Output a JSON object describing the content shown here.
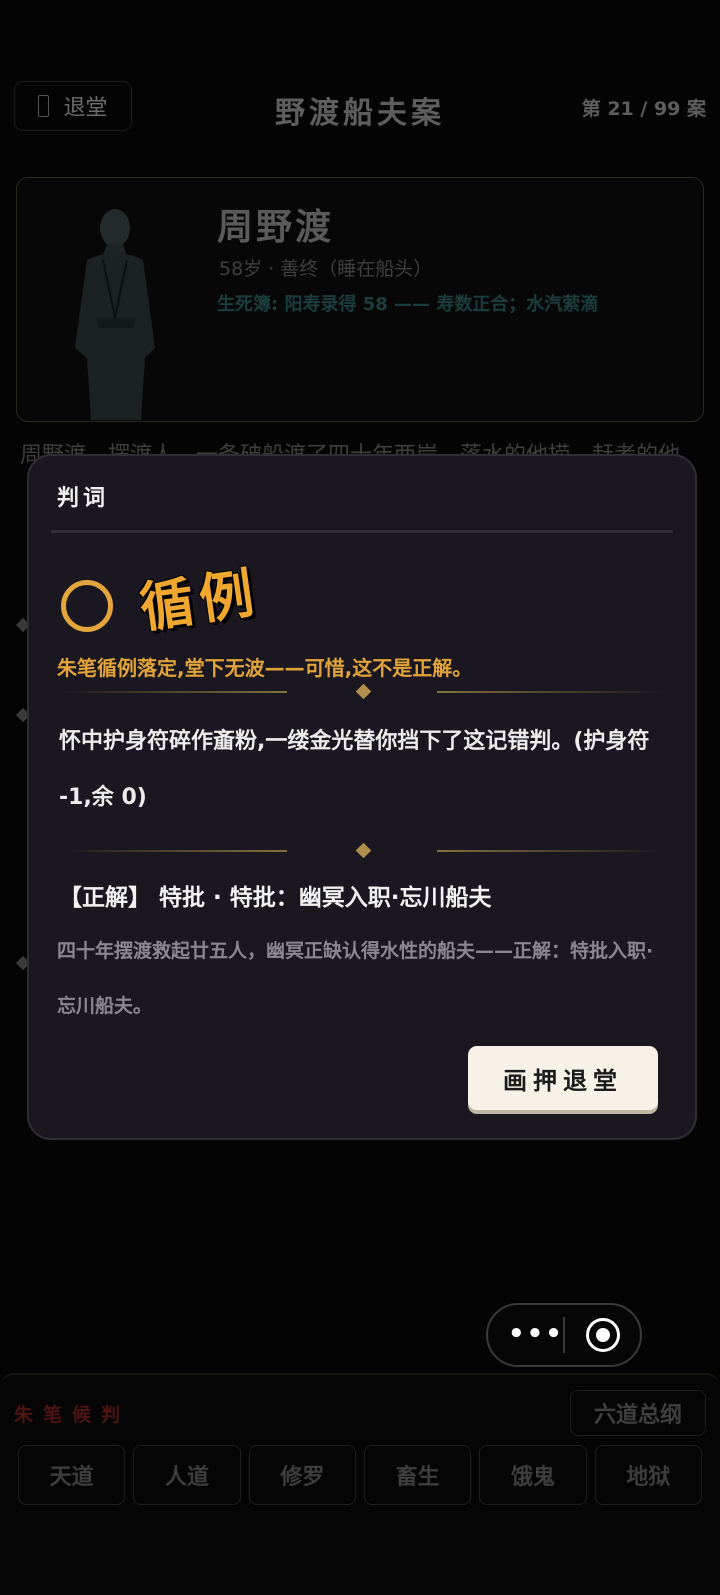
{
  "header": {
    "back_label": "退堂",
    "title": "野渡船夫案",
    "case_count": "第 21 / 99 案"
  },
  "profile": {
    "name": "周野渡",
    "meta": "58岁 · 善终（睡在船头）",
    "ledger": "生死簿: 阳寿录得 58 —— 寿数正合；水汽萦滴"
  },
  "background": {
    "desc": "周野渡，摆渡人，一条破船渡了四十年两岸，落水的他捞，赶考的他"
  },
  "modal": {
    "title": "判词",
    "verdict": "循例",
    "verdict_sub": "朱笔循例落定,堂下无波——可惜,这不是正解。",
    "effect": "怀中护身符碎作齑粉,一缕金光替你挡下了这记错判。(护身符 -1,余 0)",
    "answer_title": "【正解】 特批 · 特批：幽冥入职·忘川船夫",
    "answer_text": "四十年摆渡救起廿五人，幽冥正缺认得水性的船夫——正解：特批入职·忘川船夫。",
    "sign_button": "画押退堂"
  },
  "bottom": {
    "label": "朱笔候判",
    "summary_button": "六道总纲",
    "paths": [
      "天道",
      "人道",
      "修罗",
      "畜生",
      "饿鬼",
      "地狱"
    ]
  },
  "colors": {
    "accent_gold": "#e2a43a",
    "modal_bg": "#1a1720",
    "button_cream": "#f6f2e8"
  }
}
